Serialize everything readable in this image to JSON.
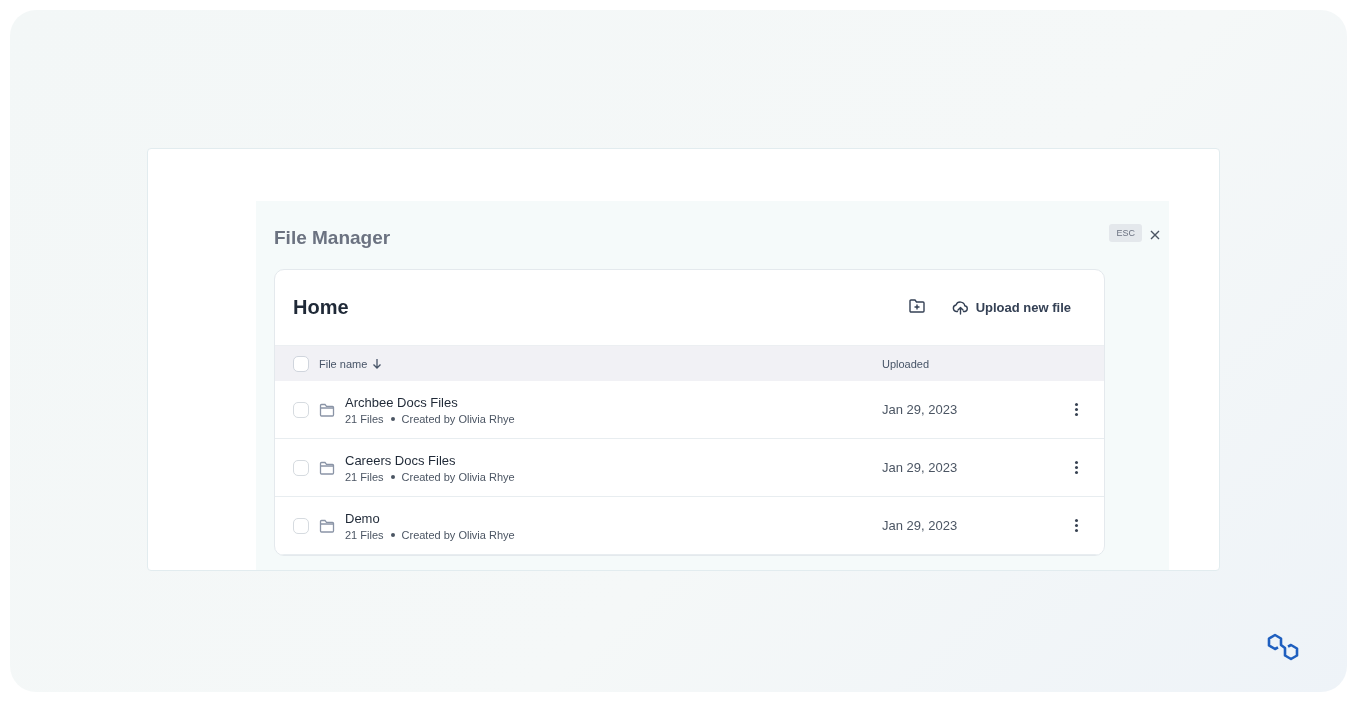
{
  "modal": {
    "title": "File Manager",
    "esc_key": "ESC"
  },
  "folder": {
    "title": "Home",
    "upload_button": "Upload new file"
  },
  "table": {
    "select_all_checked": false,
    "columns": [
      {
        "label": "File name",
        "sorted": true
      },
      {
        "label": "Uploaded",
        "sorted": false
      }
    ],
    "rows": [
      {
        "name": "Archbee Docs Files",
        "count": "21 Files",
        "creator": "Created by Olivia Rhye",
        "uploaded": "Jan 29, 2023",
        "checked": false
      },
      {
        "name": "Careers Docs Files",
        "count": "21 Files",
        "creator": "Created by Olivia Rhye",
        "uploaded": "Jan 29, 2023",
        "checked": false
      },
      {
        "name": "Demo",
        "count": "21 Files",
        "creator": "Created by Olivia Rhye",
        "uploaded": "Jan 29, 2023",
        "checked": false
      }
    ]
  }
}
